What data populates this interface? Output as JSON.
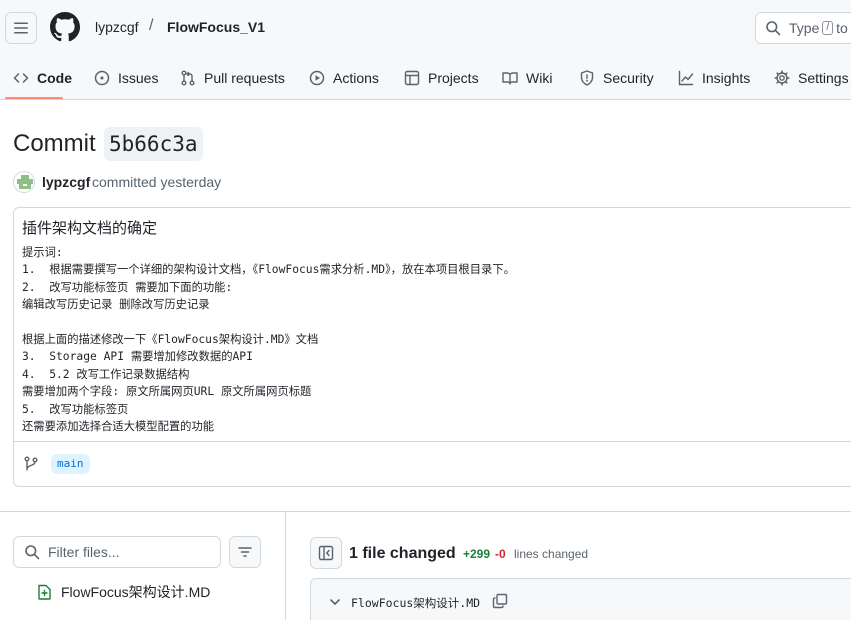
{
  "header": {
    "owner": "lypzcgf",
    "separator": "/",
    "repo": "FlowFocus_V1",
    "search_prefix": "Type",
    "search_key": "/",
    "search_suffix": "to"
  },
  "nav": {
    "items": [
      {
        "label": "Code",
        "icon": "code-icon",
        "active": true
      },
      {
        "label": "Issues",
        "icon": "issue-icon"
      },
      {
        "label": "Pull requests",
        "icon": "pull-request-icon"
      },
      {
        "label": "Actions",
        "icon": "play-icon"
      },
      {
        "label": "Projects",
        "icon": "table-icon"
      },
      {
        "label": "Wiki",
        "icon": "book-icon"
      },
      {
        "label": "Security",
        "icon": "shield-icon"
      },
      {
        "label": "Insights",
        "icon": "graph-icon"
      },
      {
        "label": "Settings",
        "icon": "gear-icon"
      }
    ],
    "accent": "#fd8c73"
  },
  "commit": {
    "title_prefix": "Commit",
    "sha": "5b66c3a",
    "author": "lypzcgf",
    "meta": "committed yesterday",
    "message_title": "插件架构文档的确定",
    "message_lines": [
      "提示词:",
      "1.  根据需要撰写一个详细的架构设计文档，《FlowFocus需求分析.MD》，放在本项目根目录下。",
      "2.  改写功能标签页 需要加下面的功能:",
      "编辑改写历史记录 删除改写历史记录",
      "",
      "根据上面的描述修改一下《FlowFocus架构设计.MD》文档",
      "3.  Storage API 需要增加修改数据的API",
      "4.  5.2 改写工作记录数据结构",
      "需要增加两个字段: 原文所属网页URL 原文所属网页标题",
      "5.  改写功能标签页",
      "还需要添加选择合适大模型配置的功能"
    ],
    "branch": "main"
  },
  "files": {
    "filter_placeholder": "Filter files...",
    "tree": [
      {
        "name": "FlowFocus架构设计.MD",
        "icon": "file-added-icon"
      }
    ]
  },
  "diff": {
    "summary": "1 file changed",
    "additions": "+299",
    "deletions": "-0",
    "lines_changed": "lines changed",
    "file_name": "FlowFocus架构设计.MD"
  },
  "colors": {
    "addition": "#1a7f37",
    "deletion": "#d1242f",
    "branch_bg": "#ddf4ff",
    "branch_fg": "#0969da"
  }
}
